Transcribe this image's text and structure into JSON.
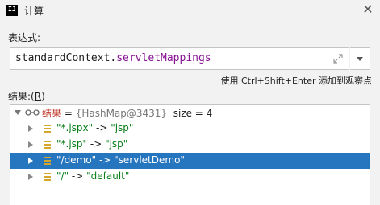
{
  "window": {
    "title": "计算",
    "app_icon_text": "IJ"
  },
  "expression": {
    "label": "表达式:",
    "object": "standardContext",
    "separator": ".",
    "field": "servletMappings"
  },
  "hint": "使用 Ctrl+Shift+Enter 添加到观察点",
  "result": {
    "label_prefix": "结果:(",
    "label_mnemonic": "R",
    "label_suffix": ")",
    "root": {
      "name": "结果",
      "eq": " = ",
      "type": "{HashMap@3431}",
      "size": "  size = 4"
    },
    "entries": [
      {
        "key": "\"*.jspx\"",
        "arrow": " -> ",
        "value": "\"jsp\""
      },
      {
        "key": "\"*.jsp\"",
        "arrow": " -> ",
        "value": "\"jsp\""
      },
      {
        "key": "\"/demo\"",
        "arrow": " -> ",
        "value": "\"servletDemo\"",
        "selected": true
      },
      {
        "key": "\"/\"",
        "arrow": " -> ",
        "value": "\"default\""
      }
    ]
  },
  "colors": {
    "selection": "#2675bf",
    "string_value": "#067d17",
    "result_name": "#c0392b",
    "field_name": "#871094",
    "field_icon": "#d4a72c"
  }
}
